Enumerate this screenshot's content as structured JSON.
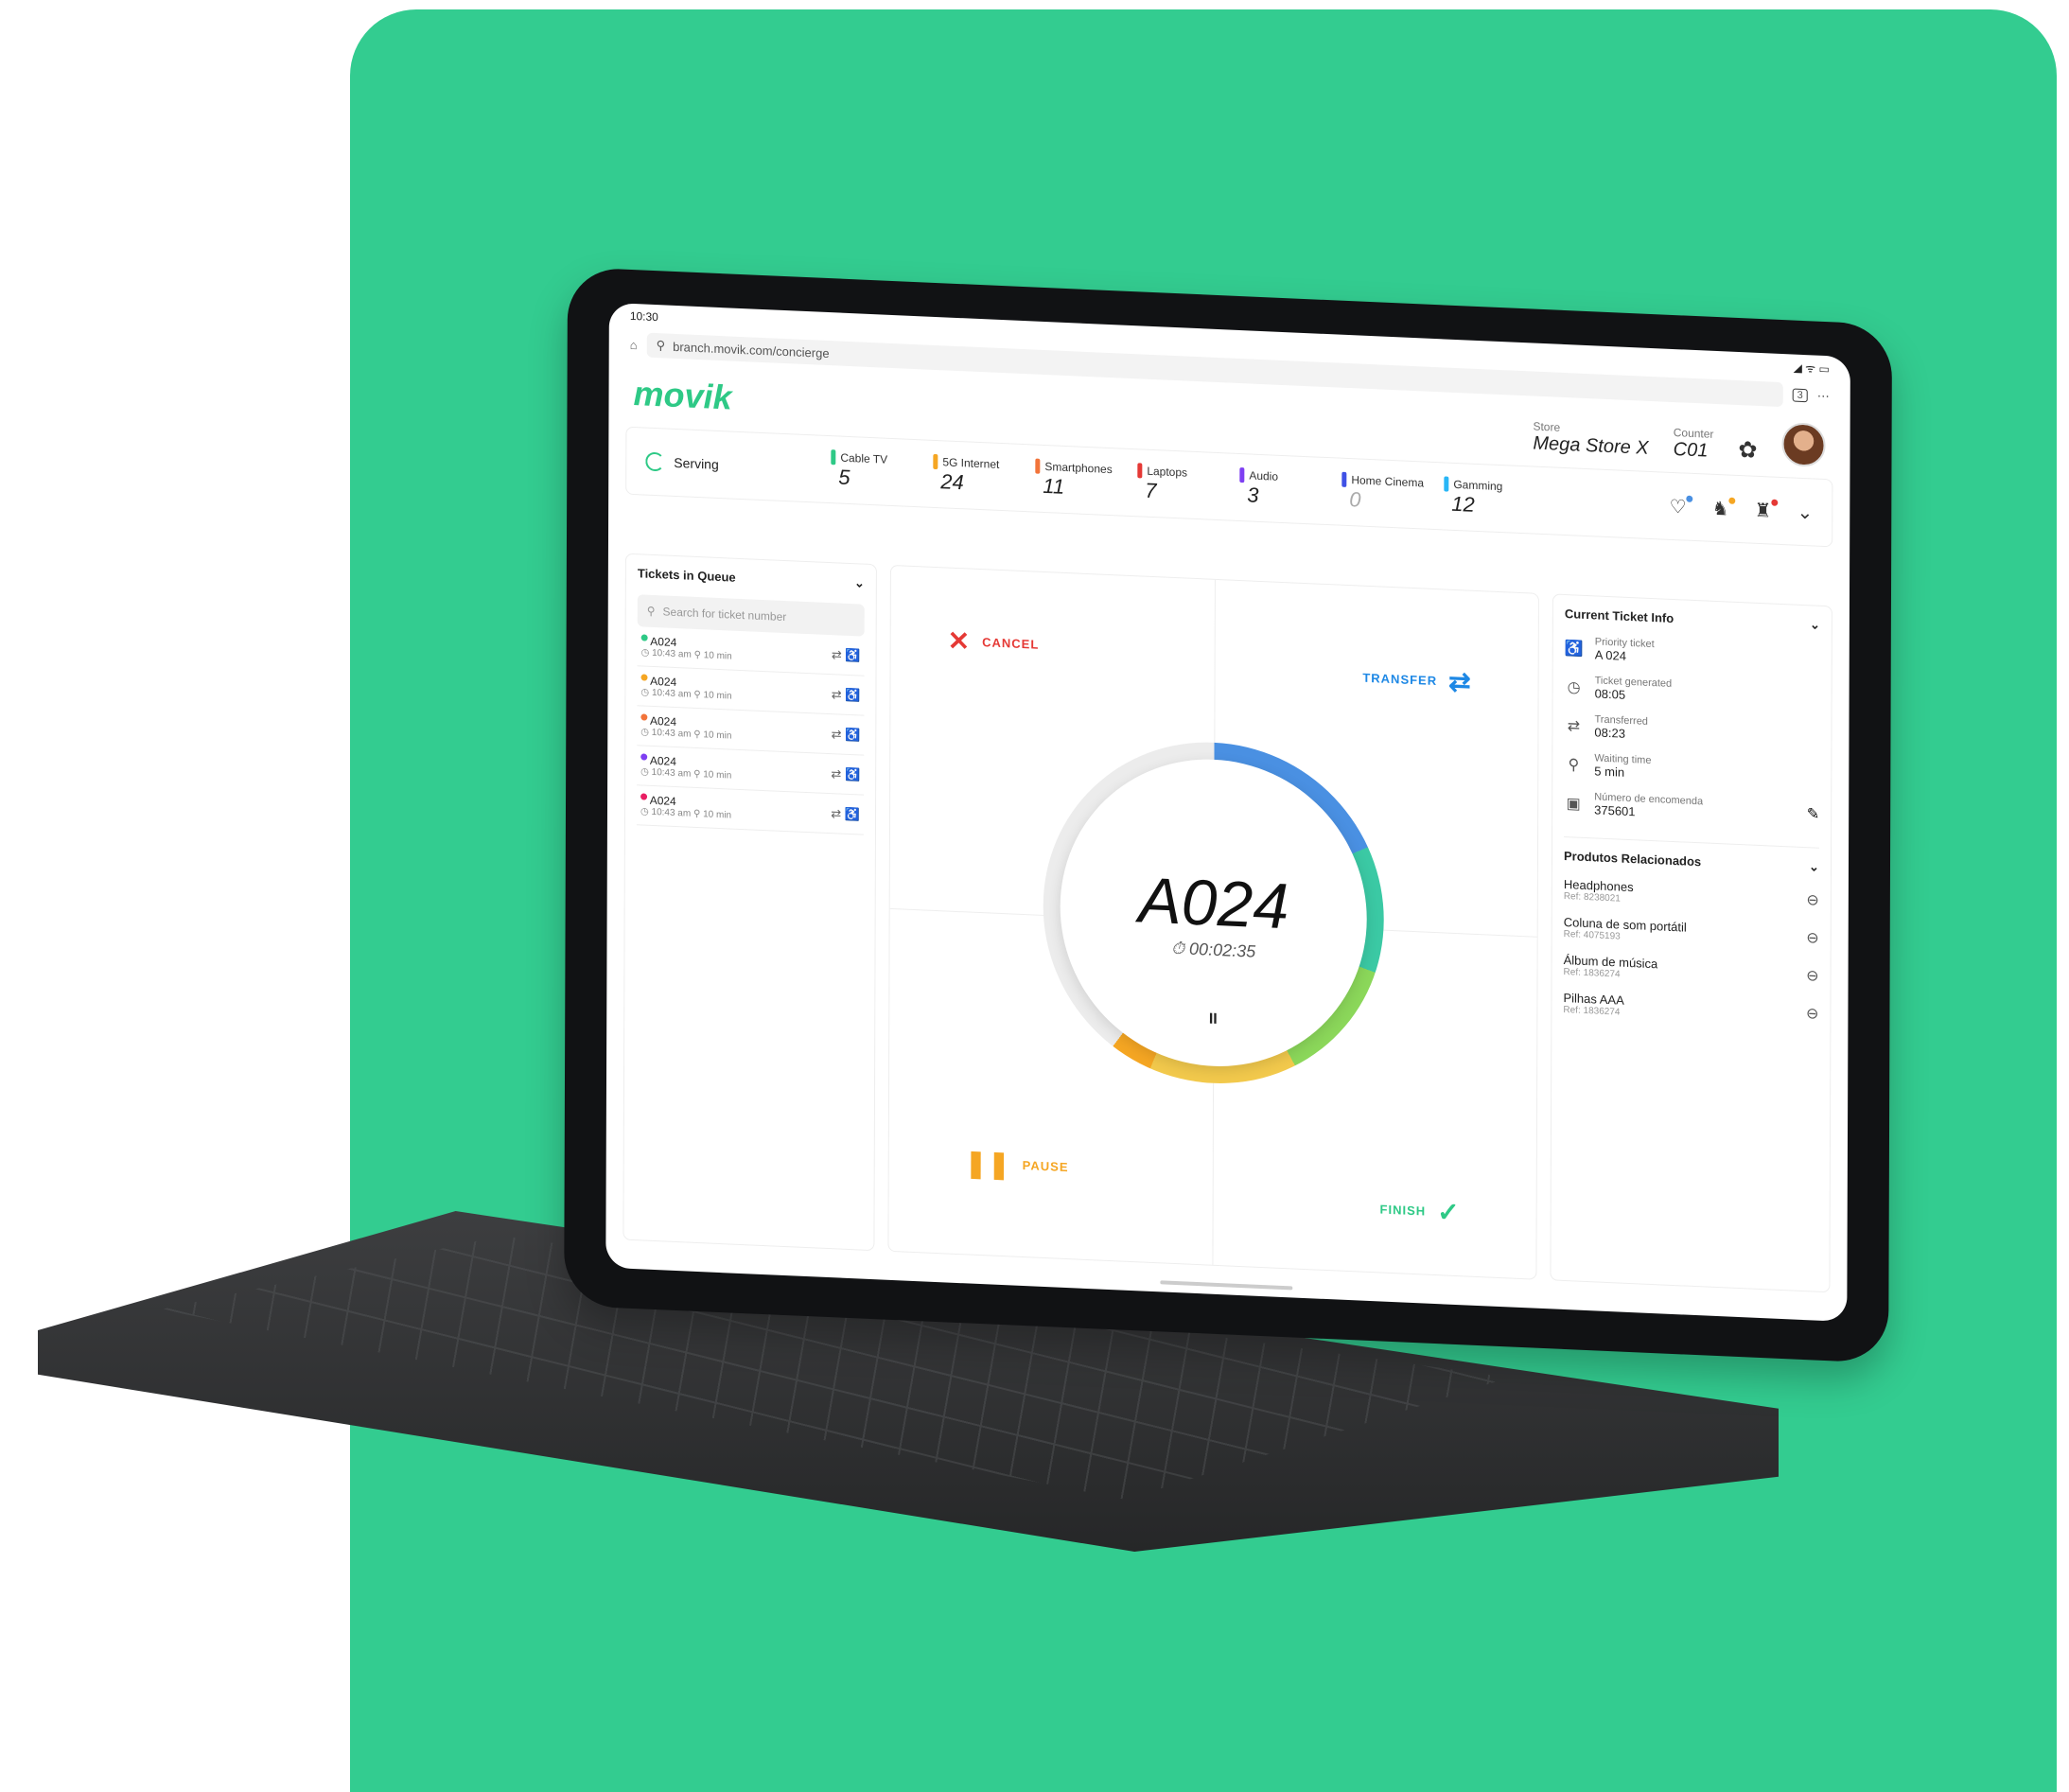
{
  "status_bar": {
    "time": "10:30",
    "indicators": "◢ ᯤ ▭"
  },
  "browser": {
    "url": "branch.movik.com/concierge",
    "tab_count": "3",
    "more": "⋯"
  },
  "app": {
    "logo": "movik"
  },
  "header": {
    "store_label": "Store",
    "store_value": "Mega Store X",
    "counter_label": "Counter",
    "counter_value": "C01",
    "settings_icon": "gear-icon",
    "avatar_icon": "avatar"
  },
  "queue": {
    "serving_label": "Serving",
    "categories": [
      {
        "name": "Cable TV",
        "count": "5",
        "color": "#2ec986"
      },
      {
        "name": "5G Internet",
        "count": "24",
        "color": "#f5a623"
      },
      {
        "name": "Smartphones",
        "count": "11",
        "color": "#f2743a"
      },
      {
        "name": "Laptops",
        "count": "7",
        "color": "#e53935"
      },
      {
        "name": "Audio",
        "count": "3",
        "color": "#7e3ff2"
      },
      {
        "name": "Home Cinema",
        "count": "0",
        "color": "#3f51e5"
      },
      {
        "name": "Gamming",
        "count": "12",
        "color": "#29b6f6"
      }
    ],
    "icon_dots": [
      "#4a90e2",
      "#f5a623",
      "#e53935"
    ]
  },
  "tickets_panel": {
    "title": "Tickets in Queue",
    "search_placeholder": "Search for ticket number",
    "tickets": [
      {
        "id": "A024",
        "time": "10:43 am",
        "wait": "10 min",
        "color": "#2ec986"
      },
      {
        "id": "A024",
        "time": "10:43 am",
        "wait": "10 min",
        "color": "#f5a623"
      },
      {
        "id": "A024",
        "time": "10:43 am",
        "wait": "10 min",
        "color": "#f2743a"
      },
      {
        "id": "A024",
        "time": "10:43 am",
        "wait": "10 min",
        "color": "#7e3ff2"
      },
      {
        "id": "A024",
        "time": "10:43 am",
        "wait": "10 min",
        "color": "#e91e63"
      }
    ]
  },
  "center": {
    "cancel": "CANCEL",
    "transfer": "TRANSFER",
    "pause": "PAUSE",
    "finish": "FINISH",
    "ticket_number": "A024",
    "timer": "00:02:35",
    "pause_symbol": "II",
    "colors": {
      "cancel": "#e53935",
      "transfer": "#1e88e5",
      "pause": "#f5a623",
      "finish": "#2ec986"
    }
  },
  "info_panel": {
    "title": "Current Ticket Info",
    "rows": [
      {
        "label": "Priority ticket",
        "value": "A 024",
        "icon": "wheelchair-icon"
      },
      {
        "label": "Ticket generated",
        "value": "08:05",
        "icon": "clock-icon"
      },
      {
        "label": "Transferred",
        "value": "08:23",
        "icon": "transfer-icon"
      },
      {
        "label": "Waiting time",
        "value": "5 min",
        "icon": "walking-icon"
      },
      {
        "label": "Número de encomenda",
        "value": "375601",
        "icon": "bag-icon"
      }
    ],
    "products_title": "Produtos Relacionados",
    "products": [
      {
        "name": "Headphones",
        "ref": "Ref: 8238021"
      },
      {
        "name": "Coluna de som portátil",
        "ref": "Ref: 4075193"
      },
      {
        "name": "Álbum de música",
        "ref": "Ref: 1836274"
      },
      {
        "name": "Pilhas AAA",
        "ref": "Ref: 1836274"
      }
    ]
  }
}
